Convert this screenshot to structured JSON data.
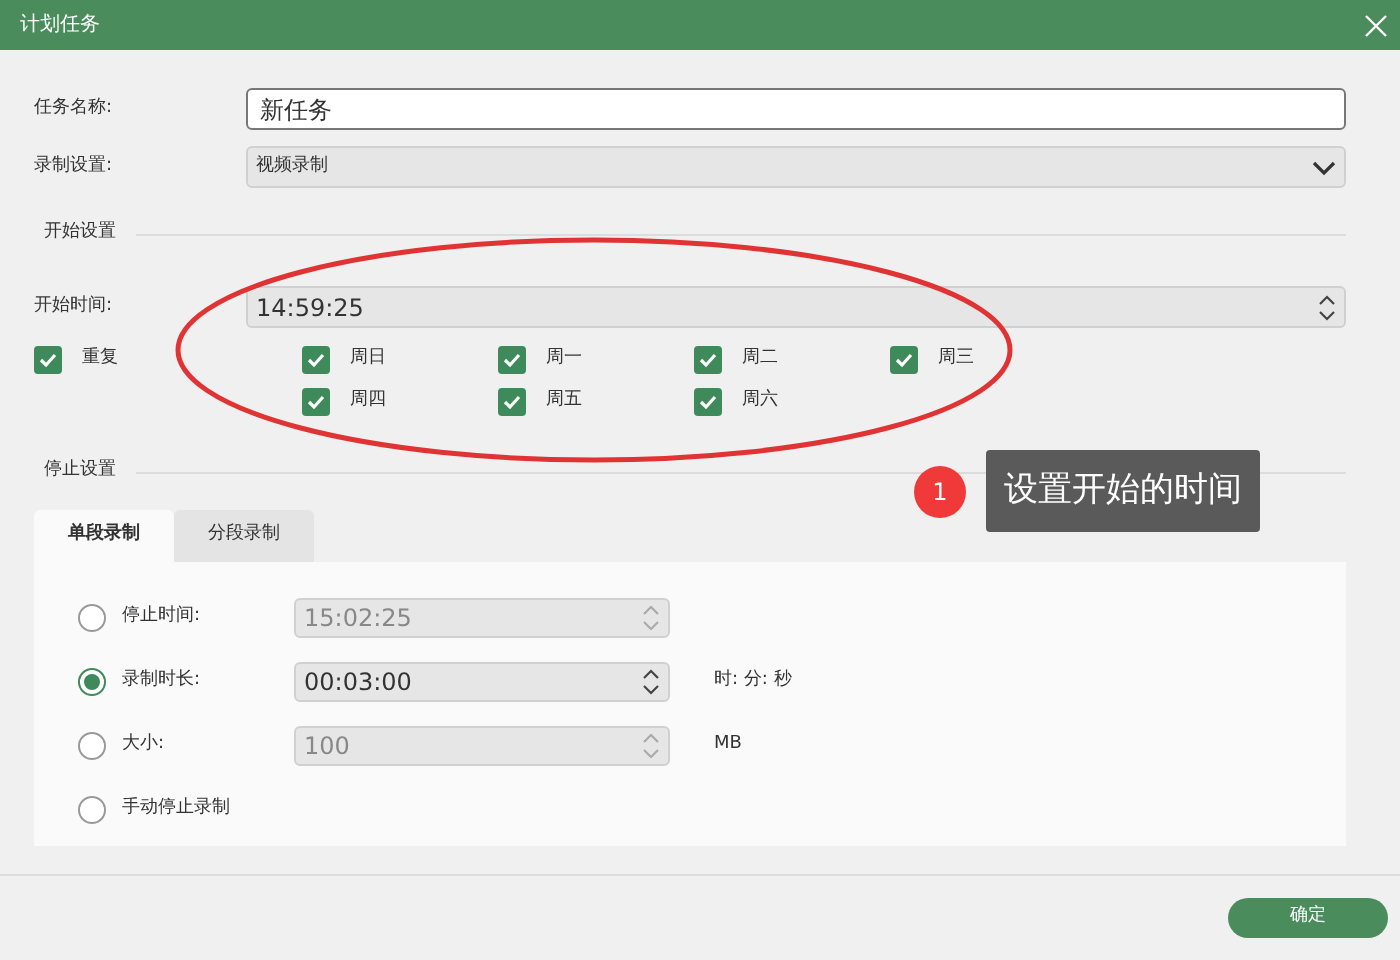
{
  "window": {
    "title": "计划任务"
  },
  "task_name": {
    "label": "任务名称:",
    "value": "新任务"
  },
  "record_setting": {
    "label": "录制设置:",
    "value": "视频录制"
  },
  "start_section": {
    "title": "开始设置",
    "start_time": {
      "label": "开始时间:",
      "value": "14:59:25"
    },
    "repeat": {
      "label": "重复",
      "checked": true
    },
    "days": [
      {
        "label": "周日",
        "checked": true
      },
      {
        "label": "周一",
        "checked": true
      },
      {
        "label": "周二",
        "checked": true
      },
      {
        "label": "周三",
        "checked": true
      },
      {
        "label": "周四",
        "checked": true
      },
      {
        "label": "周五",
        "checked": true
      },
      {
        "label": "周六",
        "checked": true
      }
    ]
  },
  "stop_section": {
    "title": "停止设置",
    "tabs": [
      {
        "label": "单段录制",
        "selected": true
      },
      {
        "label": "分段录制",
        "selected": false
      }
    ],
    "options": [
      {
        "label": "停止时间:",
        "selected": false,
        "value": "15:02:25"
      },
      {
        "label": "录制时长:",
        "selected": true,
        "value": "00:03:00",
        "unit": "时: 分: 秒"
      },
      {
        "label": "大小:",
        "selected": false,
        "value": "100",
        "unit": "MB"
      },
      {
        "label": "手动停止录制",
        "selected": false
      }
    ]
  },
  "annotation": {
    "number": "1",
    "text": "设置开始的时间"
  },
  "buttons": [
    {
      "label": "确定"
    }
  ]
}
